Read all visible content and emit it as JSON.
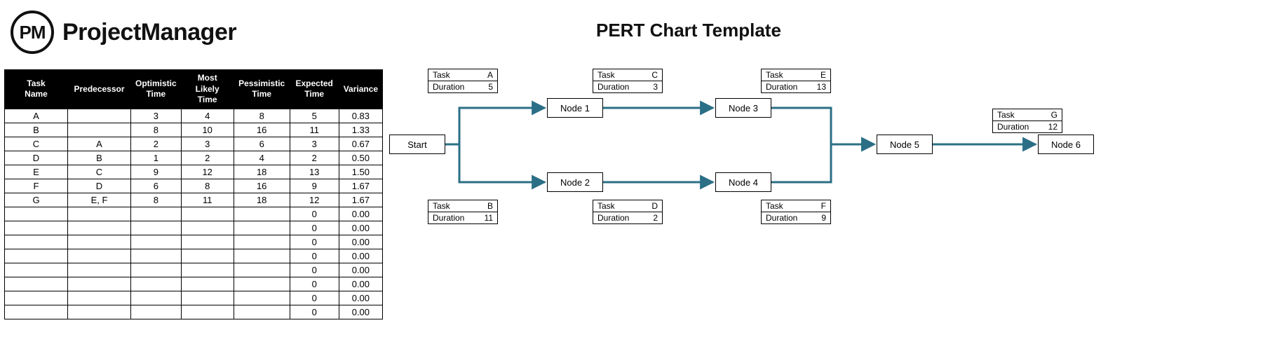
{
  "brand": {
    "abbrev": "PM",
    "name": "ProjectManager"
  },
  "title": "PERT Chart Template",
  "table": {
    "headers": {
      "task": "Task Name",
      "pred": "Predecessor",
      "opt": "Optimistic Time",
      "ml": "Most Likely Time",
      "pes": "Pessimistic Time",
      "exp": "Expected Time",
      "var": "Variance"
    },
    "rows": [
      {
        "task": "A",
        "pred": "",
        "opt": "3",
        "ml": "4",
        "pes": "8",
        "exp": "5",
        "var": "0.83"
      },
      {
        "task": "B",
        "pred": "",
        "opt": "8",
        "ml": "10",
        "pes": "16",
        "exp": "11",
        "var": "1.33"
      },
      {
        "task": "C",
        "pred": "A",
        "opt": "2",
        "ml": "3",
        "pes": "6",
        "exp": "3",
        "var": "0.67"
      },
      {
        "task": "D",
        "pred": "B",
        "opt": "1",
        "ml": "2",
        "pes": "4",
        "exp": "2",
        "var": "0.50"
      },
      {
        "task": "E",
        "pred": "C",
        "opt": "9",
        "ml": "12",
        "pes": "18",
        "exp": "13",
        "var": "1.50"
      },
      {
        "task": "F",
        "pred": "D",
        "opt": "6",
        "ml": "8",
        "pes": "16",
        "exp": "9",
        "var": "1.67"
      },
      {
        "task": "G",
        "pred": "E, F",
        "opt": "8",
        "ml": "11",
        "pes": "18",
        "exp": "12",
        "var": "1.67"
      },
      {
        "task": "",
        "pred": "",
        "opt": "",
        "ml": "",
        "pes": "",
        "exp": "0",
        "var": "0.00"
      },
      {
        "task": "",
        "pred": "",
        "opt": "",
        "ml": "",
        "pes": "",
        "exp": "0",
        "var": "0.00"
      },
      {
        "task": "",
        "pred": "",
        "opt": "",
        "ml": "",
        "pes": "",
        "exp": "0",
        "var": "0.00"
      },
      {
        "task": "",
        "pred": "",
        "opt": "",
        "ml": "",
        "pes": "",
        "exp": "0",
        "var": "0.00"
      },
      {
        "task": "",
        "pred": "",
        "opt": "",
        "ml": "",
        "pes": "",
        "exp": "0",
        "var": "0.00"
      },
      {
        "task": "",
        "pred": "",
        "opt": "",
        "ml": "",
        "pes": "",
        "exp": "0",
        "var": "0.00"
      },
      {
        "task": "",
        "pred": "",
        "opt": "",
        "ml": "",
        "pes": "",
        "exp": "0",
        "var": "0.00"
      },
      {
        "task": "",
        "pred": "",
        "opt": "",
        "ml": "",
        "pes": "",
        "exp": "0",
        "var": "0.00"
      }
    ]
  },
  "pert": {
    "labels": {
      "task": "Task",
      "duration": "Duration"
    },
    "nodes": {
      "start": "Start",
      "node1": "Node 1",
      "node2": "Node 2",
      "node3": "Node 3",
      "node4": "Node 4",
      "node5": "Node 5",
      "node6": "Node 6"
    },
    "info": {
      "a": {
        "task": "A",
        "duration": "5"
      },
      "b": {
        "task": "B",
        "duration": "11"
      },
      "c": {
        "task": "C",
        "duration": "3"
      },
      "d": {
        "task": "D",
        "duration": "2"
      },
      "e": {
        "task": "E",
        "duration": "13"
      },
      "f": {
        "task": "F",
        "duration": "9"
      },
      "g": {
        "task": "G",
        "duration": "12"
      }
    }
  },
  "chart_data": {
    "type": "table",
    "title": "PERT Chart Template",
    "tasks": [
      {
        "name": "A",
        "predecessors": [],
        "optimistic": 3,
        "most_likely": 4,
        "pessimistic": 8,
        "expected": 5,
        "variance": 0.83
      },
      {
        "name": "B",
        "predecessors": [],
        "optimistic": 8,
        "most_likely": 10,
        "pessimistic": 16,
        "expected": 11,
        "variance": 1.33
      },
      {
        "name": "C",
        "predecessors": [
          "A"
        ],
        "optimistic": 2,
        "most_likely": 3,
        "pessimistic": 6,
        "expected": 3,
        "variance": 0.67
      },
      {
        "name": "D",
        "predecessors": [
          "B"
        ],
        "optimistic": 1,
        "most_likely": 2,
        "pessimistic": 4,
        "expected": 2,
        "variance": 0.5
      },
      {
        "name": "E",
        "predecessors": [
          "C"
        ],
        "optimistic": 9,
        "most_likely": 12,
        "pessimistic": 18,
        "expected": 13,
        "variance": 1.5
      },
      {
        "name": "F",
        "predecessors": [
          "D"
        ],
        "optimistic": 6,
        "most_likely": 8,
        "pessimistic": 16,
        "expected": 9,
        "variance": 1.67
      },
      {
        "name": "G",
        "predecessors": [
          "E",
          "F"
        ],
        "optimistic": 8,
        "most_likely": 11,
        "pessimistic": 18,
        "expected": 12,
        "variance": 1.67
      }
    ],
    "network": {
      "nodes": [
        "Start",
        "Node 1",
        "Node 2",
        "Node 3",
        "Node 4",
        "Node 5",
        "Node 6"
      ],
      "edges": [
        {
          "from": "Start",
          "to": "Node 1",
          "task": "A",
          "duration": 5
        },
        {
          "from": "Start",
          "to": "Node 2",
          "task": "B",
          "duration": 11
        },
        {
          "from": "Node 1",
          "to": "Node 3",
          "task": "C",
          "duration": 3
        },
        {
          "from": "Node 2",
          "to": "Node 4",
          "task": "D",
          "duration": 2
        },
        {
          "from": "Node 3",
          "to": "Node 5",
          "task": "E",
          "duration": 13
        },
        {
          "from": "Node 4",
          "to": "Node 5",
          "task": "F",
          "duration": 9
        },
        {
          "from": "Node 5",
          "to": "Node 6",
          "task": "G",
          "duration": 12
        }
      ]
    }
  }
}
